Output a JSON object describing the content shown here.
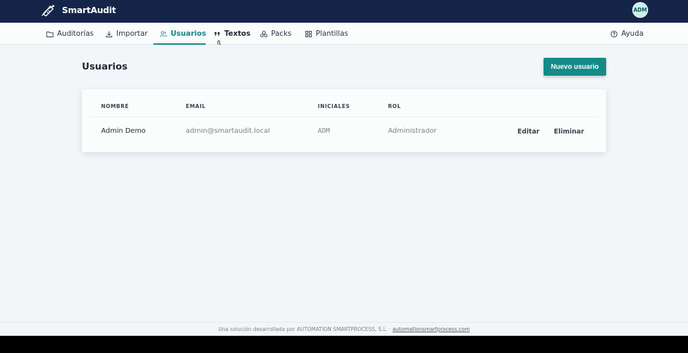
{
  "app": {
    "name": "SmartAudit",
    "user_initials": "ADM"
  },
  "nav": {
    "items": [
      {
        "label": "Auditorías",
        "icon": "folder-icon"
      },
      {
        "label": "Importar",
        "icon": "download-icon"
      },
      {
        "label": "Usuarios",
        "icon": "users-icon",
        "active": true
      },
      {
        "label": "Textos",
        "icon": "quote-icon"
      },
      {
        "label": "Packs",
        "icon": "packs-icon"
      },
      {
        "label": "Plantillas",
        "icon": "grid-icon"
      }
    ],
    "help": {
      "label": "Ayuda",
      "icon": "help-circle-icon"
    }
  },
  "page": {
    "title": "Usuarios",
    "new_button": "Nuevo usuario"
  },
  "table": {
    "headers": [
      "NOMBRE",
      "EMAIL",
      "INICIALES",
      "ROL"
    ],
    "rows": [
      {
        "nombre": "Admin Demo",
        "email": "admin@smartaudit.local",
        "iniciales": "ADM",
        "rol": "Administrador",
        "edit": "Editar",
        "delete": "Eliminar"
      }
    ]
  },
  "footer": {
    "text": "Una solución desarrollada por AUTOMATION SMARTPROCESS, S.L. ·",
    "link": "automationsmartprocess.com"
  },
  "colors": {
    "topbar": "#15254a",
    "accent": "#148887",
    "background": "#f3f6f8"
  }
}
